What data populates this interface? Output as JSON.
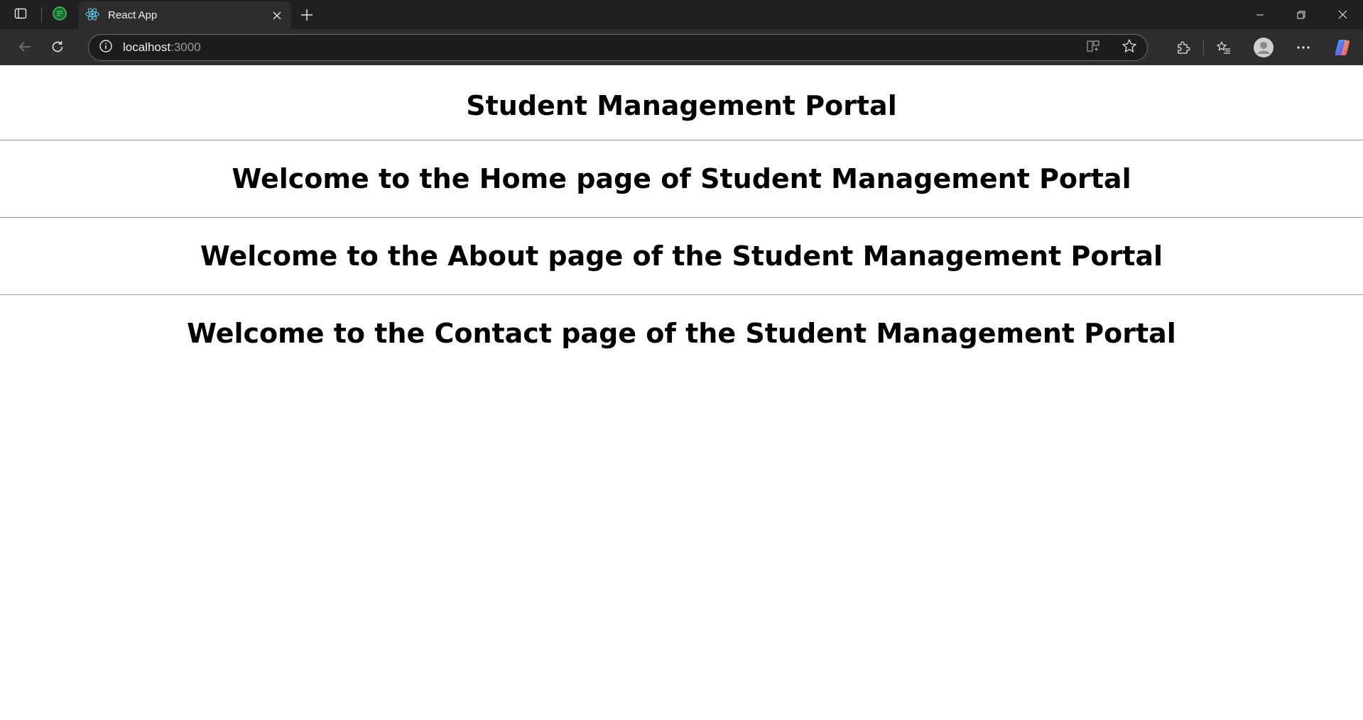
{
  "browser": {
    "active_tab_title": "React App",
    "url_host": "localhost",
    "url_port": ":3000"
  },
  "icons": {
    "tab_actions": "tab-actions-icon",
    "pinned_tab": "chat-app-icon",
    "react_favicon": "react-logo-icon",
    "tab_close": "close-icon",
    "new_tab": "plus-icon",
    "minimize": "minimize-icon",
    "restore": "restore-icon",
    "close_window": "close-icon",
    "back": "back-arrow-icon",
    "refresh": "refresh-icon",
    "site_info": "info-icon",
    "split_screen": "split-screen-icon",
    "favorite": "star-icon",
    "extensions": "puzzle-icon",
    "favorites": "favorites-list-icon",
    "profile": "profile-icon",
    "more": "more-icon",
    "copilot": "copilot-icon"
  },
  "colors": {
    "tabstrip_bg": "#202020",
    "toolbar_bg": "#2e2e2e",
    "page_bg": "#ffffff",
    "text": "#000000",
    "divider": "#9c9c9c"
  },
  "page": {
    "heading": "Student Management Portal",
    "home_message": "Welcome to the Home page of Student Management Portal",
    "about_message": "Welcome to the About page of the Student Management Portal",
    "contact_message": "Welcome to the Contact page of the Student Management Portal"
  }
}
